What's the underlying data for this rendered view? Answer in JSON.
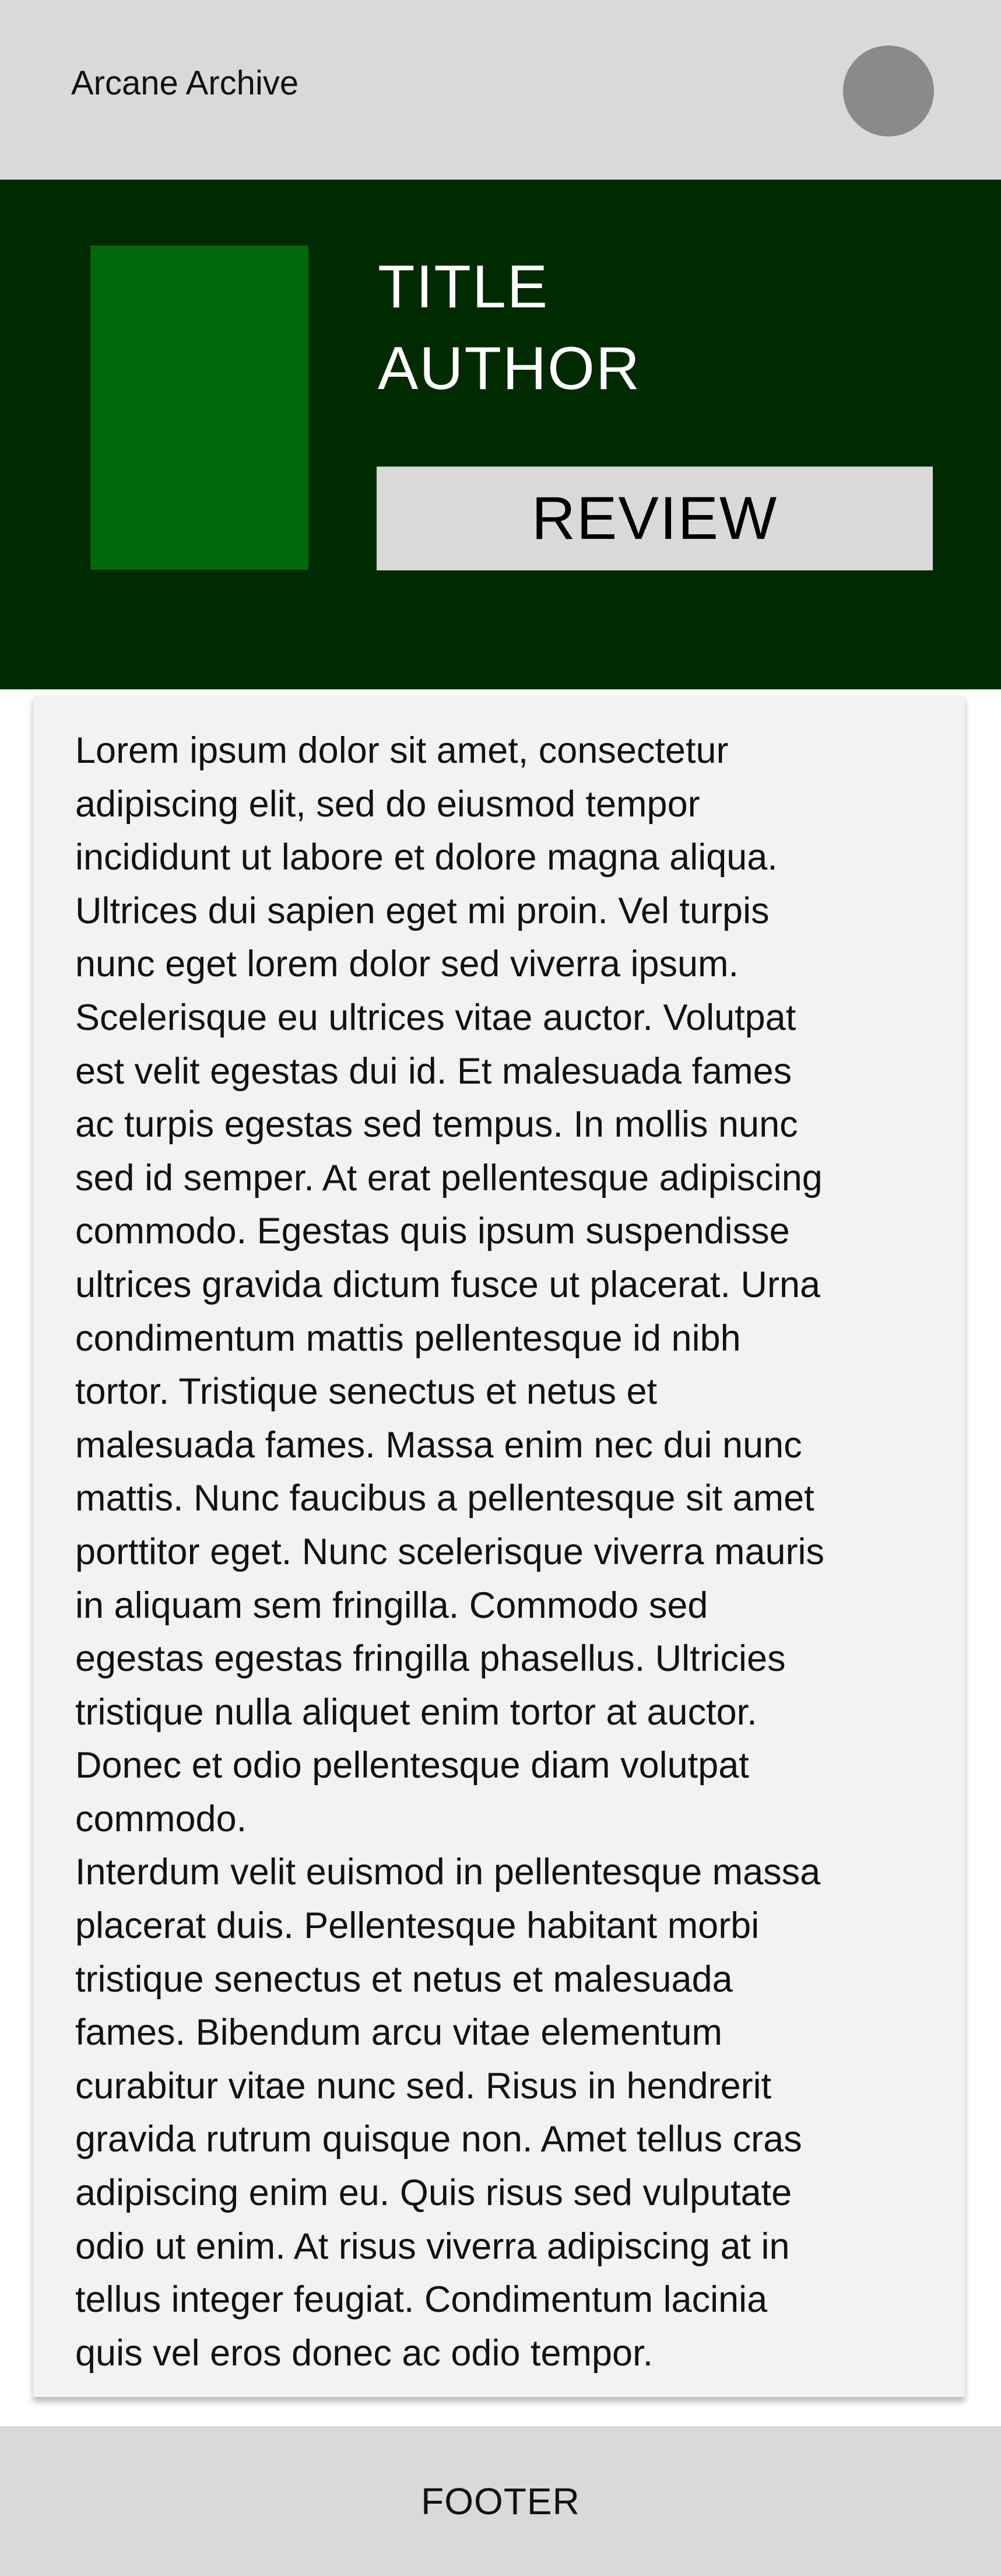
{
  "header": {
    "app_title": "Arcane Archive"
  },
  "book": {
    "title": "TITLE",
    "author": "AUTHOR",
    "review_label": "REVIEW"
  },
  "content": {
    "paragraphs": [
      "Lorem  ipsum dolor sit amet, consectetur\nadipiscing elit, sed do eiusmod  tempor\nincididunt ut labore et dolore magna aliqua.\nUltrices dui sapien  eget mi proin. Vel turpis\nnunc eget lorem dolor sed viverra ipsum.\nScelerisque eu ultrices vitae auctor. Volutpat\nest velit egestas dui id.  Et malesuada fames\nac turpis egestas sed tempus. In mollis nunc\nsed id  semper. At erat pellentesque adipiscing\ncommodo. Egestas quis ipsum  suspendisse\nultrices gravida dictum fusce ut placerat. Urna\ncondimentum  mattis pellentesque id nibh\ntortor. Tristique senectus et netus et\nmalesuada fames. Massa enim nec dui nunc\nmattis. Nunc faucibus a  pellentesque sit amet\nporttitor eget. Nunc scelerisque viverra mauris\nin  aliquam sem fringilla. Commodo sed\negestas egestas fringilla phasellus.  Ultricies\ntristique nulla aliquet enim tortor at auctor.\nDonec et odio  pellentesque diam volutpat\ncommodo.",
      "Interdum velit euismod in pellentesque massa\nplacerat duis.  Pellentesque habitant morbi\ntristique senectus et netus et malesuada\nfames. Bibendum arcu vitae elementum\ncurabitur vitae nunc sed. Risus in  hendrerit\ngravida rutrum quisque non. Amet tellus cras\nadipiscing enim  eu. Quis risus sed vulputate\nodio ut enim. At risus viverra adipiscing  at in\ntellus integer feugiat. Condimentum lacinia\nquis vel eros donec ac  odio tempor."
    ]
  },
  "footer": {
    "label": "FOOTER"
  },
  "colors": {
    "header_bg": "#d9d9d9",
    "hero_bg": "#002a00",
    "cover": "#006a0a",
    "avatar": "#8a8a8a",
    "card_bg": "#f2f2f2"
  }
}
